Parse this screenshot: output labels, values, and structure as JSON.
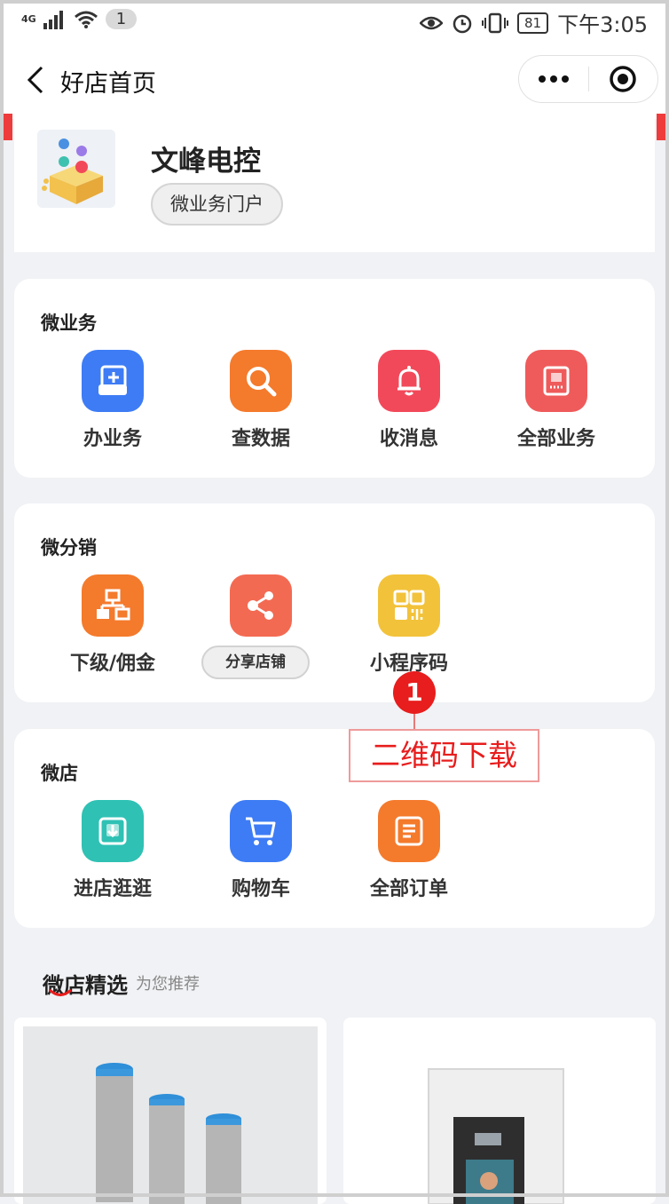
{
  "status_bar": {
    "network": "4G",
    "notification_count": "1",
    "battery": "81",
    "time": "下午3:05"
  },
  "nav": {
    "title": "好店首页"
  },
  "store": {
    "name": "文峰电控",
    "portal_button": "微业务门户"
  },
  "sections": [
    {
      "title": "微业务",
      "items": [
        {
          "label": "办业务",
          "icon": "add-document-icon",
          "color": "#3d7cf5"
        },
        {
          "label": "查数据",
          "icon": "search-icon",
          "color": "#f47a2c"
        },
        {
          "label": "收消息",
          "icon": "bell-icon",
          "color": "#f2495a"
        },
        {
          "label": "全部业务",
          "icon": "receipt-icon",
          "color": "#ef5b5b"
        }
      ]
    },
    {
      "title": "微分销",
      "items": [
        {
          "label": "下级/佣金",
          "icon": "org-chart-icon",
          "color": "#f47a2c"
        },
        {
          "label": "分享店铺",
          "icon": "share-icon",
          "color": "#f36a52"
        },
        {
          "label": "小程序码",
          "icon": "qr-code-icon",
          "color": "#f2c23a"
        }
      ]
    },
    {
      "title": "微店",
      "items": [
        {
          "label": "进店逛逛",
          "icon": "enter-store-icon",
          "color": "#2fc1b4"
        },
        {
          "label": "购物车",
          "icon": "cart-icon",
          "color": "#3d7cf5"
        },
        {
          "label": "全部订单",
          "icon": "order-list-icon",
          "color": "#f47a2c"
        }
      ]
    }
  ],
  "annotation": {
    "number": "1",
    "text": "二维码下载"
  },
  "recommend": {
    "title": "微店精选",
    "subtitle": "为您推荐"
  }
}
